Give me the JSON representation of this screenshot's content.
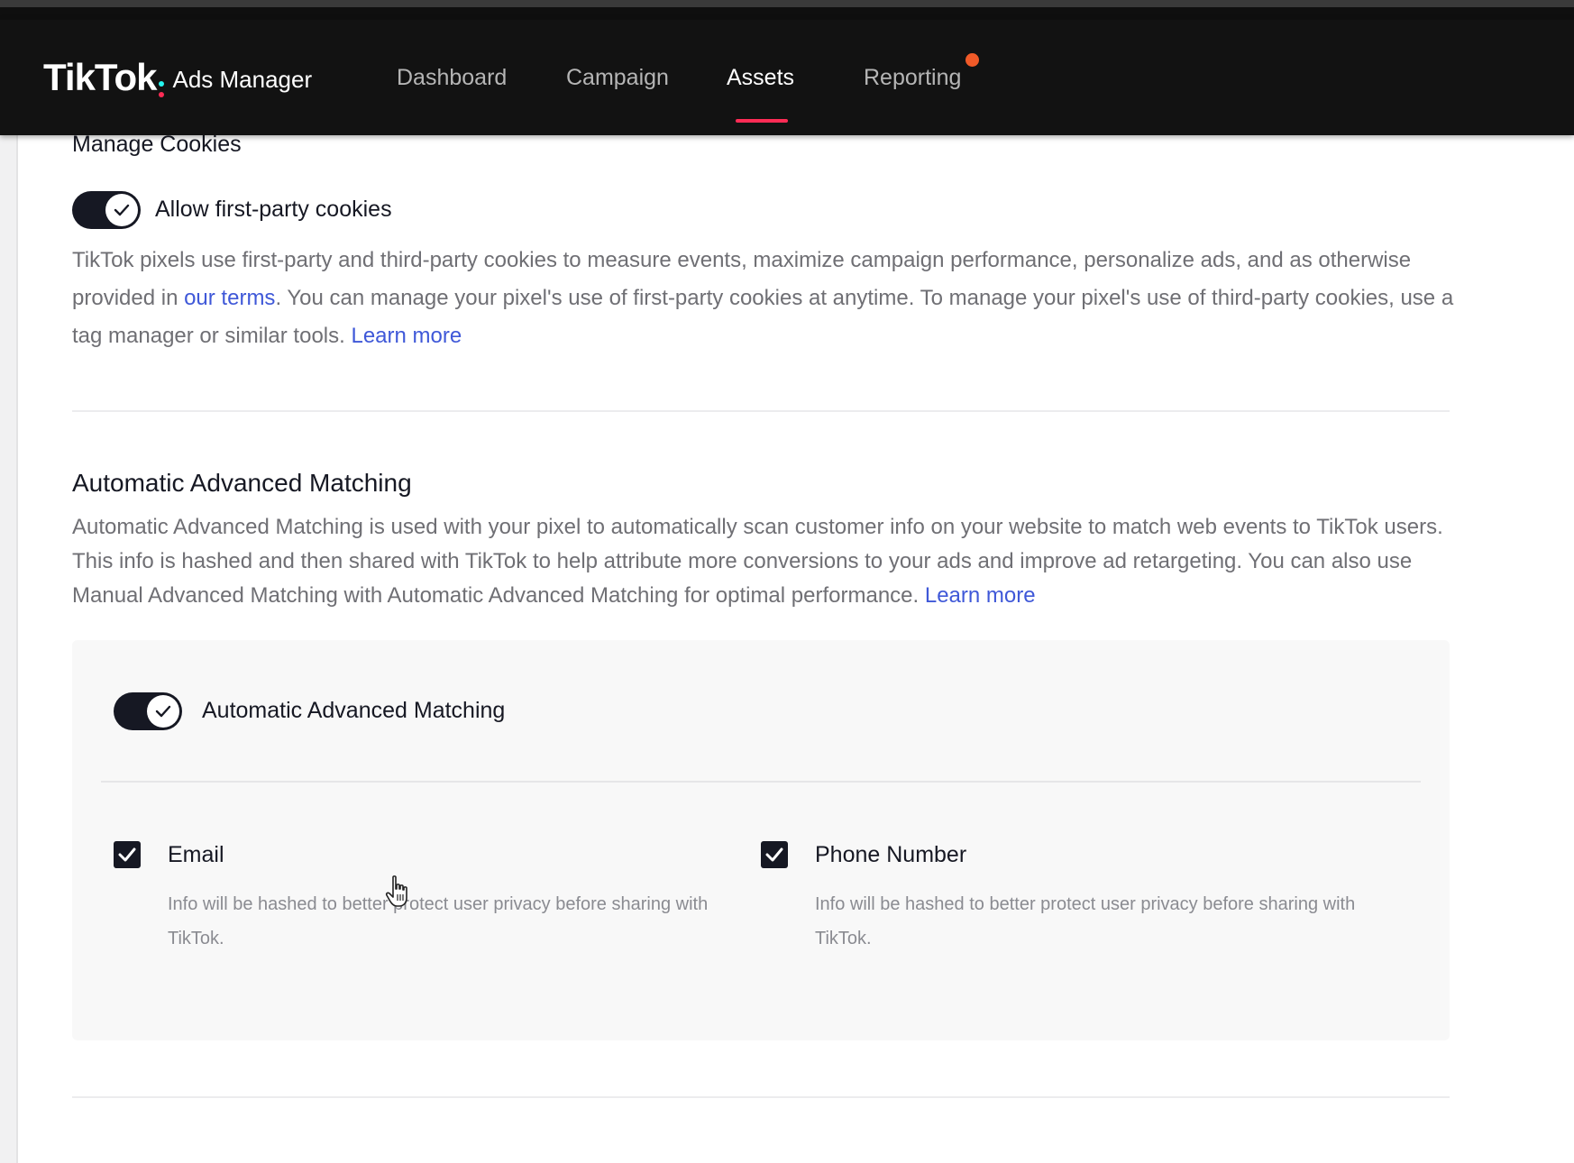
{
  "header": {
    "logo_word": "TikTok",
    "logo_product": "Ads Manager",
    "nav": [
      "Dashboard",
      "Campaign",
      "Assets",
      "Reporting"
    ],
    "active_nav": "Assets",
    "notification_dot_color": "#f05a28",
    "active_underline_color": "#fe2c55"
  },
  "cookies": {
    "heading": "Manage Cookies",
    "toggle_label": "Allow first-party cookies",
    "toggle_on": true,
    "desc_part1": "TikTok pixels use first-party and third-party cookies to measure events, maximize campaign performance, personalize ads, and as otherwise provided in ",
    "terms_link": "our terms",
    "desc_part2": ". You can manage your pixel's use of first-party cookies at anytime. To manage your pixel's use of third-party cookies, use a tag manager or similar tools. ",
    "learn_more": "Learn more"
  },
  "aam": {
    "title": "Automatic Advanced Matching",
    "desc": "Automatic Advanced Matching is used with your pixel to automatically scan customer info on your website to match web events to TikTok users. This info is hashed and then shared with TikTok to help attribute more conversions to your ads and improve ad retargeting. You can also use Manual Advanced Matching with Automatic Advanced Matching for optimal performance. ",
    "learn_more": "Learn more",
    "toggle_label": "Automatic Advanced Matching",
    "toggle_on": true,
    "options": [
      {
        "label": "Email",
        "checked": true,
        "hint": "Info will be hashed to better protect user privacy before sharing with TikTok."
      },
      {
        "label": "Phone Number",
        "checked": true,
        "hint": "Info will be hashed to better protect user privacy before sharing with TikTok."
      }
    ]
  },
  "colors": {
    "link": "#3f58d8",
    "toggle_on": "#161823",
    "panel_bg": "#f8f8f8"
  },
  "icons": [
    "tiktok-logo",
    "check-icon",
    "checkbox-check-icon",
    "hand-pointer-cursor-icon"
  ]
}
